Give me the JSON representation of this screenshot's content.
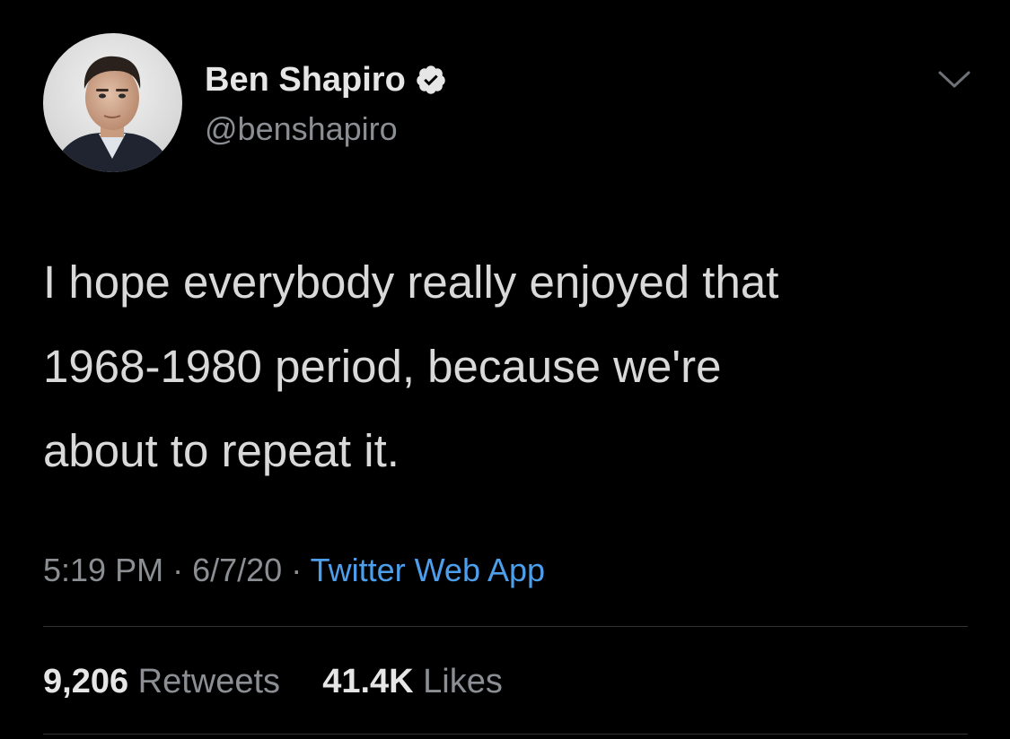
{
  "colors": {
    "background": "#000000",
    "text_primary": "#d9d9d9",
    "text_secondary": "#8b8e93",
    "link": "#4d9fec",
    "divider": "#2f3336"
  },
  "user": {
    "display_name": "Ben Shapiro",
    "handle": "@benshapiro",
    "verified": true,
    "verified_icon": "verified-badge-icon",
    "avatar": "profile-photo"
  },
  "menu": {
    "icon": "chevron-down-icon"
  },
  "tweet": {
    "text_lines": [
      "I hope everybody really enjoyed that",
      "1968-1980 period, because we're",
      "about to repeat it."
    ],
    "time": "5:19 PM",
    "date": "6/7/20",
    "separator": "·",
    "source": "Twitter Web App"
  },
  "stats": {
    "retweets_count": "9,206",
    "retweets_label": "Retweets",
    "likes_count": "41.4K",
    "likes_label": "Likes"
  }
}
